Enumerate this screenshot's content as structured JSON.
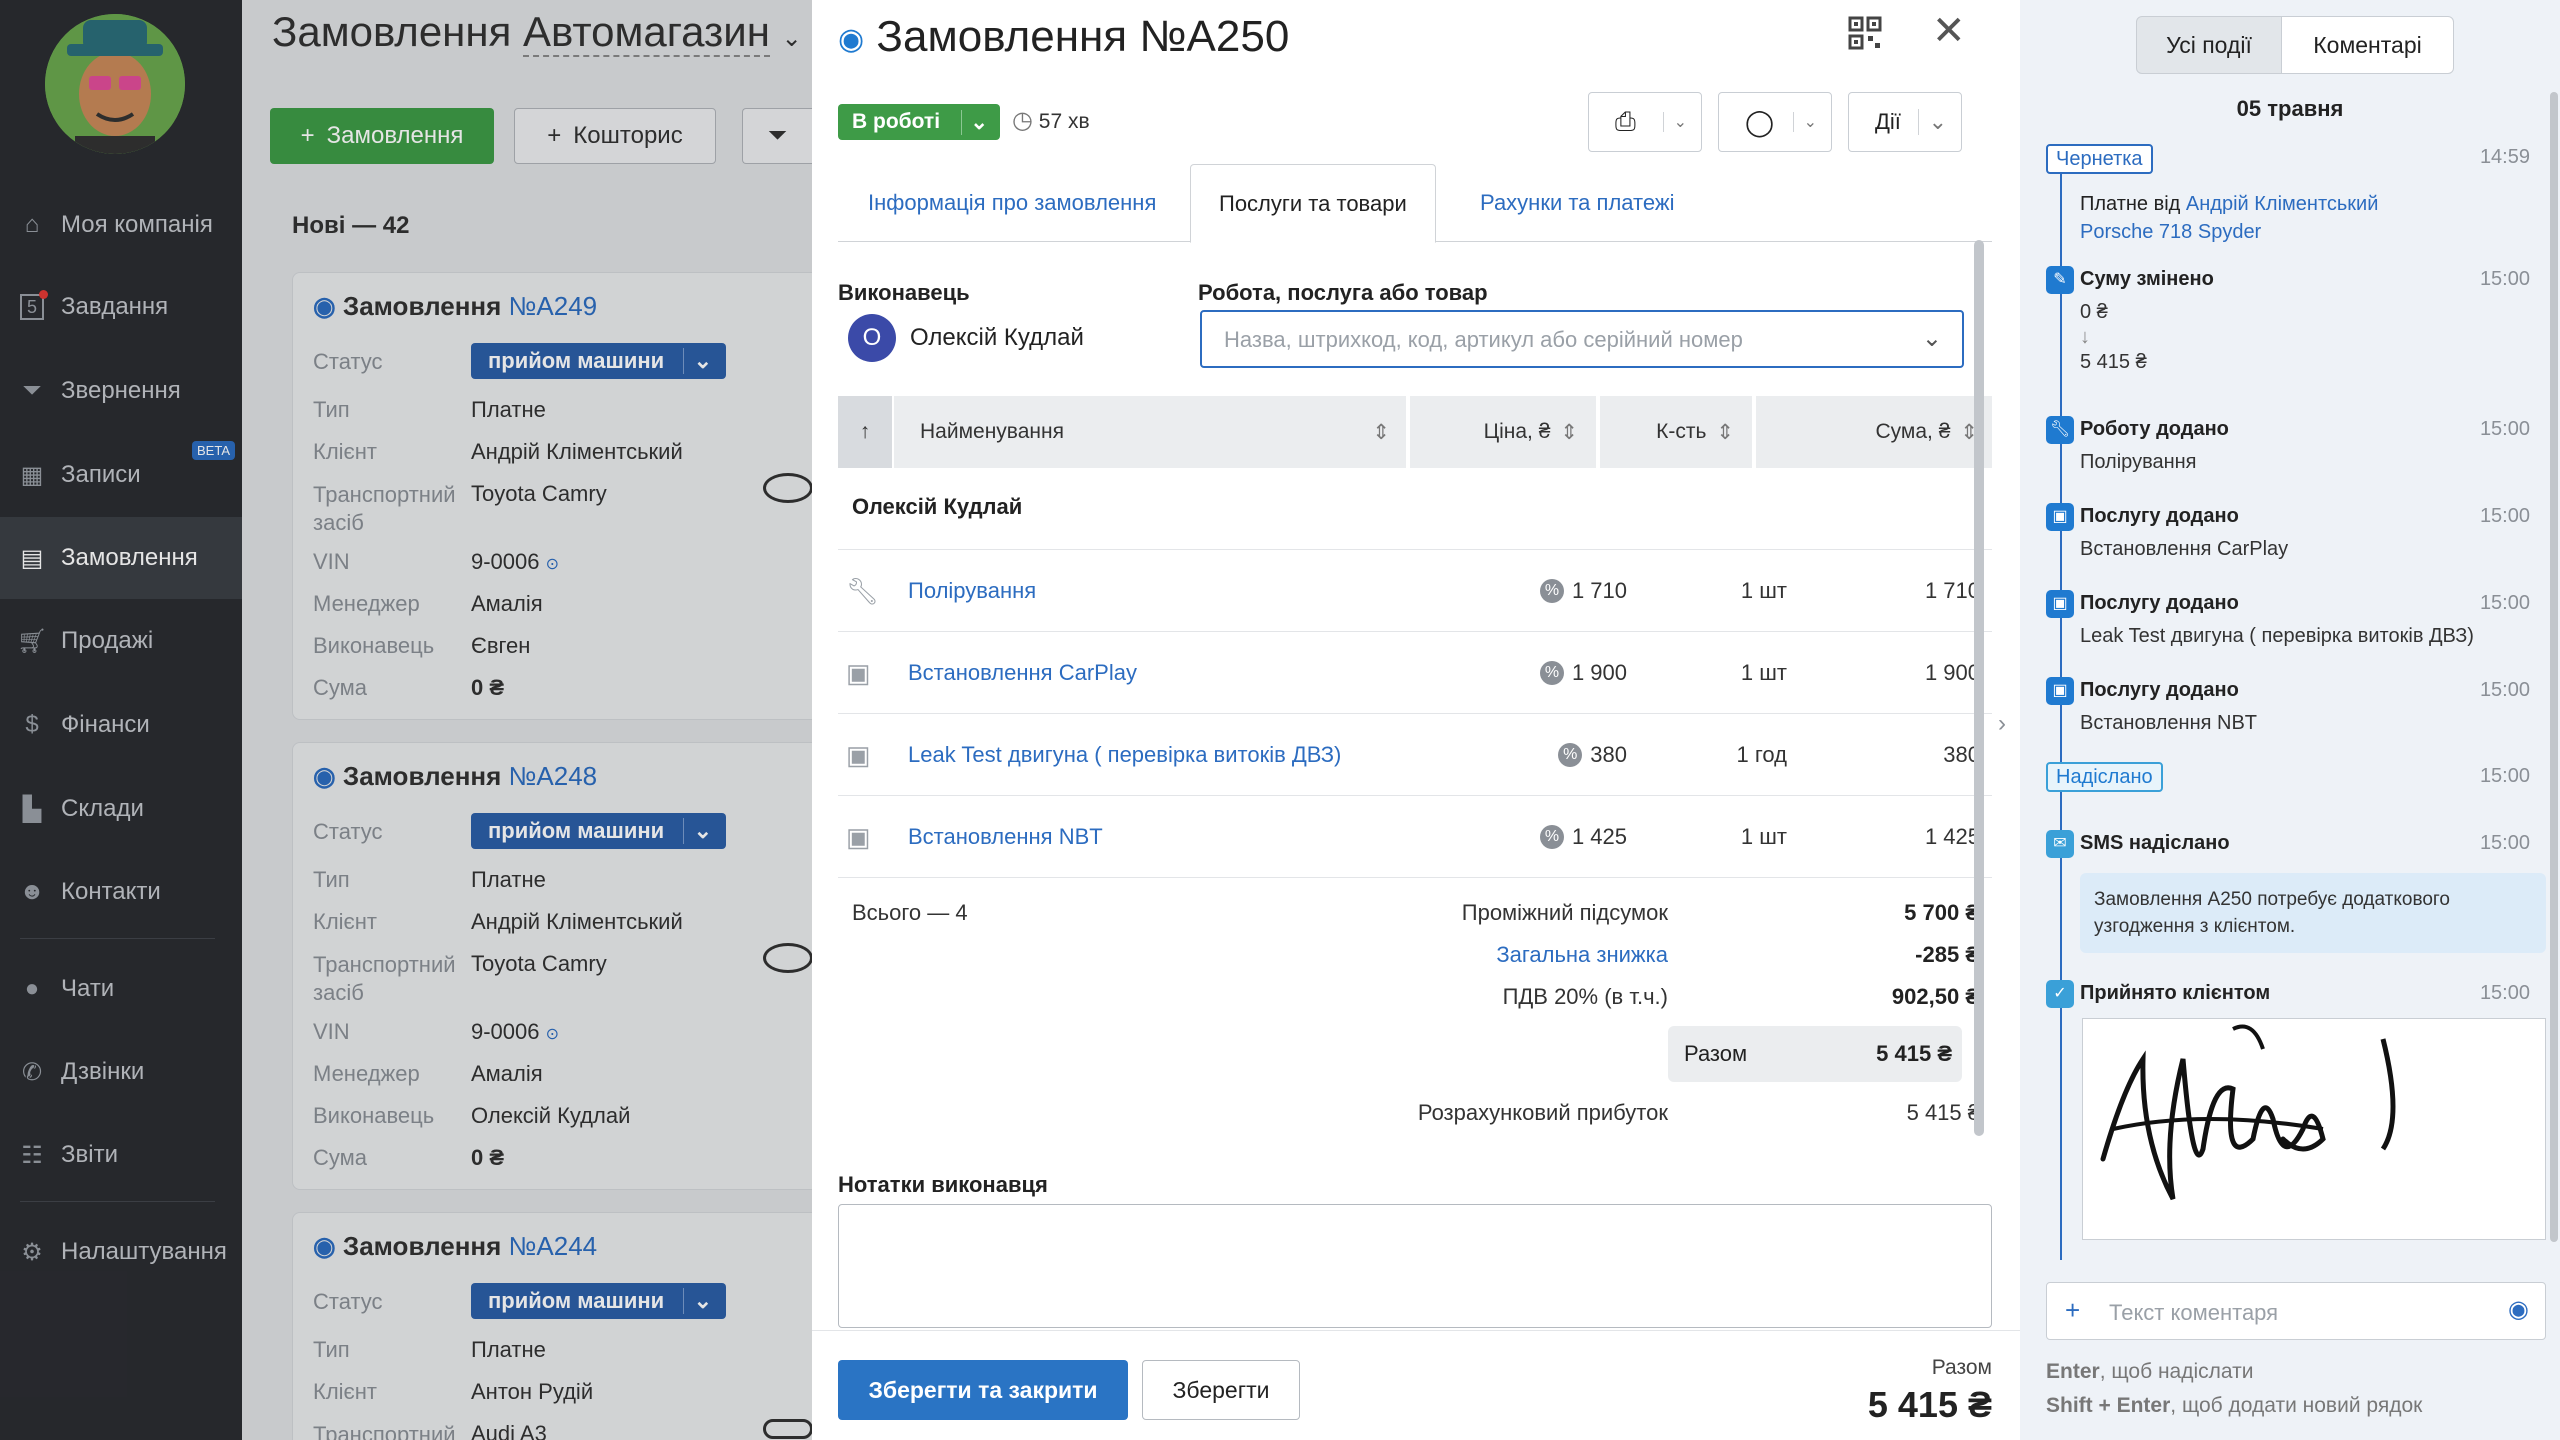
{
  "sidebar": {
    "items": [
      {
        "label": "Моя компанія",
        "icon": "home-icon"
      },
      {
        "label": "Завдання",
        "icon": "tasks-icon",
        "badge": "5"
      },
      {
        "label": "Звернення",
        "icon": "funnel-icon"
      },
      {
        "label": "Записи",
        "icon": "calendar-icon",
        "badge": "BETA"
      },
      {
        "label": "Замовлення",
        "icon": "orders-icon"
      },
      {
        "label": "Продажі",
        "icon": "cart-icon"
      },
      {
        "label": "Фінанси",
        "icon": "dollar-icon"
      },
      {
        "label": "Склади",
        "icon": "warehouse-icon"
      },
      {
        "label": "Контакти",
        "icon": "contacts-icon"
      },
      {
        "label": "Чати",
        "icon": "chat-icon"
      },
      {
        "label": "Дзвінки",
        "icon": "phone-icon"
      },
      {
        "label": "Звіти",
        "icon": "reports-icon"
      },
      {
        "label": "Налаштування",
        "icon": "gear-icon"
      }
    ]
  },
  "page": {
    "title": "Замовлення",
    "store": "Автомагазин",
    "new_order_btn": "Замовлення",
    "estimate_btn": "Кошторис",
    "column_title": "Нові — 42",
    "labels": {
      "status": "Статус",
      "type": "Тип",
      "client": "Клієнт",
      "vehicle": "Транспортний засіб",
      "vin": "VIN",
      "manager": "Менеджер",
      "executor": "Виконавець",
      "sum": "Сума"
    },
    "cards": [
      {
        "title": "Замовлення",
        "num": "№A249",
        "status": "прийом машини",
        "type": "Платне",
        "client": "Андрій Кліментський",
        "vehicle": "Toyota Camry",
        "vin": "9-0006",
        "manager": "Амалія",
        "executor": "Євген",
        "sum": "0 ₴"
      },
      {
        "title": "Замовлення",
        "num": "№A248",
        "status": "прийом машини",
        "type": "Платне",
        "client": "Андрій Кліментський",
        "vehicle": "Toyota Camry",
        "vin": "9-0006",
        "manager": "Амалія",
        "executor": "Олексій Кудлай",
        "sum": "0 ₴"
      },
      {
        "title": "Замовлення",
        "num": "№A244",
        "status": "прийом машини",
        "type": "Платне",
        "client": "Антон Рудій",
        "vehicle": "Audi A3"
      }
    ]
  },
  "modal": {
    "title": "Замовлення №A250",
    "status": "В роботі",
    "duration": "57 хв",
    "actions_label": "Дії",
    "tabs": [
      "Інформація про замовлення",
      "Послуги та товари",
      "Рахунки та платежі"
    ],
    "executor_label": "Виконавець",
    "executor_initial": "О",
    "executor_name": "Олексій Кудлай",
    "item_label": "Робота, послуга або товар",
    "item_placeholder": "Назва, штрихкод, код, артикул або серійний номер",
    "table": {
      "headers": [
        "Найменування",
        "Ціна, ₴",
        "К-сть",
        "Сума, ₴"
      ],
      "group": "Олексій Кудлай",
      "rows": [
        {
          "icon": "wrench-icon",
          "name": "Полірування",
          "price": "1 710",
          "qty": "1 шт",
          "sum": "1 710"
        },
        {
          "icon": "toolbox-icon",
          "name": "Встановлення CarPlay",
          "price": "1 900",
          "qty": "1 шт",
          "sum": "1 900"
        },
        {
          "icon": "toolbox-icon",
          "name": "Leak Test двигуна ( перевірка витоків ДВЗ)",
          "price": "380",
          "qty": "1 год",
          "sum": "380"
        },
        {
          "icon": "toolbox-icon",
          "name": "Встановлення NBT",
          "price": "1 425",
          "qty": "1 шт",
          "sum": "1 425"
        }
      ]
    },
    "totals": {
      "count": "Всього — 4",
      "subtotal_label": "Проміжний підсумок",
      "subtotal": "5 700 ₴",
      "discount_label": "Загальна знижка",
      "discount": "-285 ₴",
      "vat_label": "ПДВ 20% (в т.ч.)",
      "vat": "902,50 ₴",
      "total_label": "Разом",
      "total": "5 415 ₴",
      "profit_label": "Розрахунковий прибуток",
      "profit": "5 415 ₴"
    },
    "notes_label": "Нотатки виконавця",
    "save_close": "Зберегти та закрити",
    "save": "Зберегти",
    "footer_total_label": "Разом",
    "footer_total": "5 415 ₴"
  },
  "events": {
    "tabs": [
      "Усі події",
      "Коментарі"
    ],
    "date": "05 травня",
    "draft_tag": "Чернетка",
    "draft_time": "14:59",
    "draft_text": "Платне від",
    "draft_client": "Андрій Кліментський",
    "draft_car": "Porsche 718 Spyder",
    "sum_changed": "Суму змінено",
    "sum_time": "15:00",
    "sum_from": "0 ₴",
    "sum_to": "5 415 ₴",
    "work_added": "Роботу додано",
    "work_time": "15:00",
    "work_text": "Полірування",
    "svc1": "Послугу додано",
    "svc1_time": "15:00",
    "svc1_text": "Встановлення CarPlay",
    "svc2": "Послугу додано",
    "svc2_time": "15:00",
    "svc2_text": "Leak Test двигуна ( перевірка витоків ДВЗ)",
    "svc3": "Послугу додано",
    "svc3_time": "15:00",
    "svc3_text": "Встановлення NBT",
    "sent_tag": "Надіслано",
    "sent_time": "15:00",
    "sms": "SMS надіслано",
    "sms_time": "15:00",
    "sms_text": "Замовлення A250 потребує додаткового узгодження з клієнтом.",
    "accepted": "Прийнято клієнтом",
    "accepted_time": "15:00",
    "comment_placeholder": "Текст коментаря",
    "hint1_key": "Enter",
    "hint1": ", щоб надіслати",
    "hint2_key": "Shift + Enter",
    "hint2": ", щоб додати новий рядок"
  }
}
